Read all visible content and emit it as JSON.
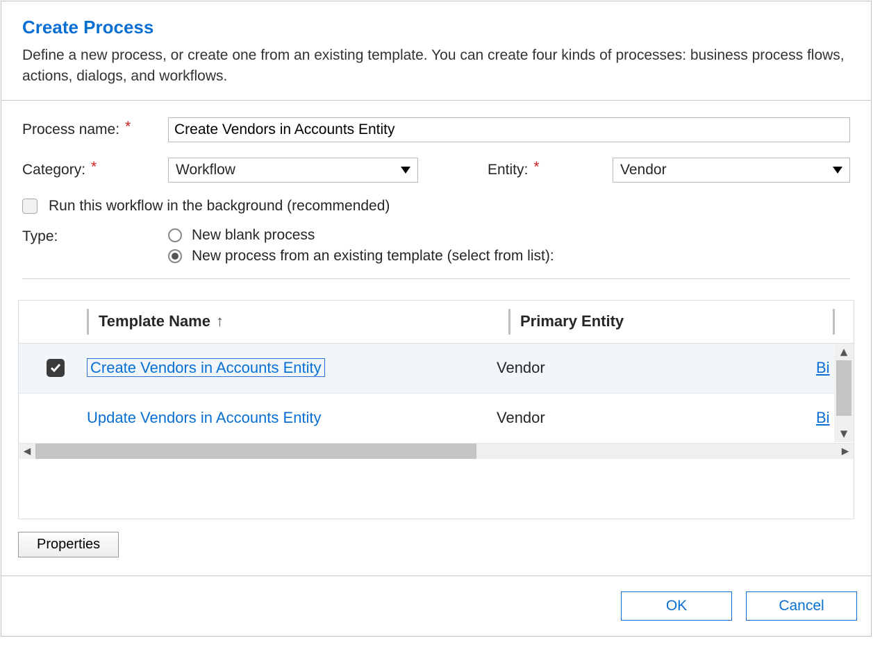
{
  "header": {
    "title": "Create Process",
    "description": "Define a new process, or create one from an existing template. You can create four kinds of processes: business process flows, actions, dialogs, and workflows."
  },
  "form": {
    "process_name_label": "Process name:",
    "process_name_value": "Create Vendors in Accounts Entity",
    "category_label": "Category:",
    "category_value": "Workflow",
    "entity_label": "Entity:",
    "entity_value": "Vendor",
    "background_label": "Run this workflow in the background (recommended)",
    "background_checked": false,
    "type_label": "Type:",
    "type_option_blank": "New blank process",
    "type_option_template": "New process from an existing template (select from list):",
    "type_selected": "template"
  },
  "grid": {
    "columns": {
      "template": "Template Name",
      "entity": "Primary Entity"
    },
    "rows": [
      {
        "selected": true,
        "template": "Create Vendors in Accounts Entity",
        "entity": "Vendor",
        "owner": "Bi"
      },
      {
        "selected": false,
        "template": "Update Vendors in Accounts Entity",
        "entity": "Vendor",
        "owner": "Bi"
      }
    ]
  },
  "buttons": {
    "properties": "Properties",
    "ok": "OK",
    "cancel": "Cancel"
  }
}
